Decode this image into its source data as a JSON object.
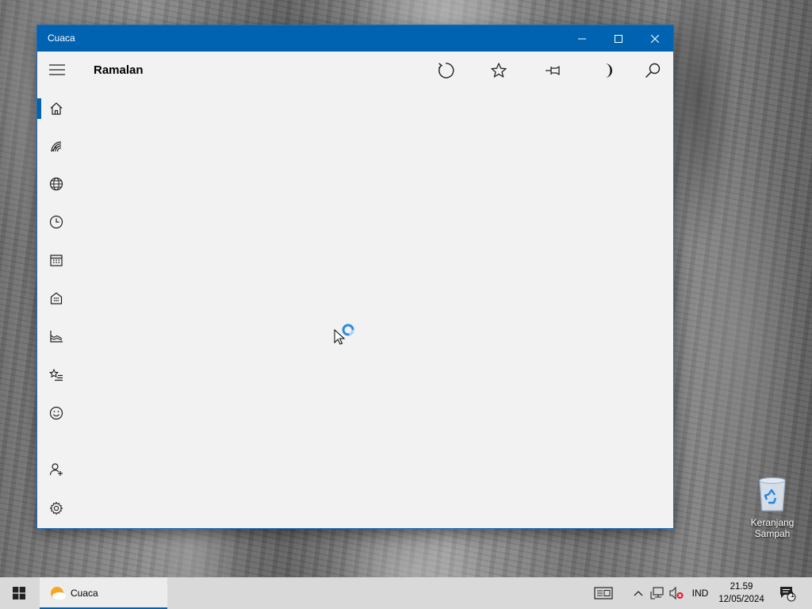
{
  "window": {
    "title": "Cuaca"
  },
  "appbar": {
    "page_title": "Ramalan"
  },
  "nav": [
    {
      "icon": "home-icon",
      "selected": true
    },
    {
      "icon": "radar-icon"
    },
    {
      "icon": "globe-icon"
    },
    {
      "icon": "clock-icon"
    },
    {
      "icon": "calendar-icon"
    },
    {
      "icon": "building-icon"
    },
    {
      "icon": "chart-icon"
    },
    {
      "icon": "star-list-icon"
    },
    {
      "icon": "smiley-icon"
    },
    {
      "icon": "add-user-icon"
    },
    {
      "icon": "settings-icon"
    }
  ],
  "desktop": {
    "recycle_bin_label": "Keranjang Sampah"
  },
  "taskbar": {
    "app_label": "Cuaca",
    "language": "IND",
    "time": "21.59",
    "date": "12/05/2024",
    "notification_count": "1"
  },
  "colors": {
    "accent": "#0063b1",
    "window_bg": "#f2f2f2",
    "taskbar_bg": "#d9d9d9"
  }
}
